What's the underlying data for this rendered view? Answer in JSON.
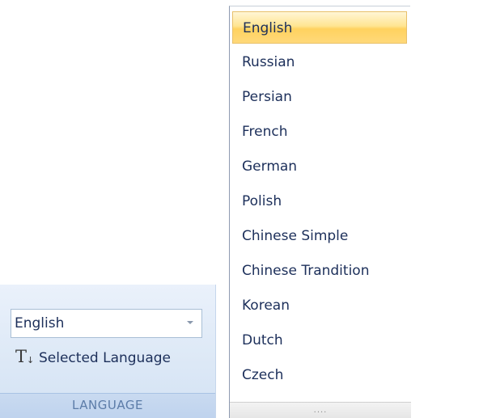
{
  "ribbon": {
    "combo_value": "English",
    "selected_language_label": "Selected Language",
    "group_label": "LANGUAGE",
    "icon": "text-direction-icon"
  },
  "dropdown": {
    "items": [
      {
        "label": "English",
        "selected": true
      },
      {
        "label": "Russian"
      },
      {
        "label": "Persian"
      },
      {
        "label": "French"
      },
      {
        "label": "German"
      },
      {
        "label": "Polish"
      },
      {
        "label": "Chinese Simple"
      },
      {
        "label": "Chinese Trandition"
      },
      {
        "label": "Korean"
      },
      {
        "label": "Dutch"
      },
      {
        "label": "Czech"
      }
    ],
    "grip": "...."
  }
}
